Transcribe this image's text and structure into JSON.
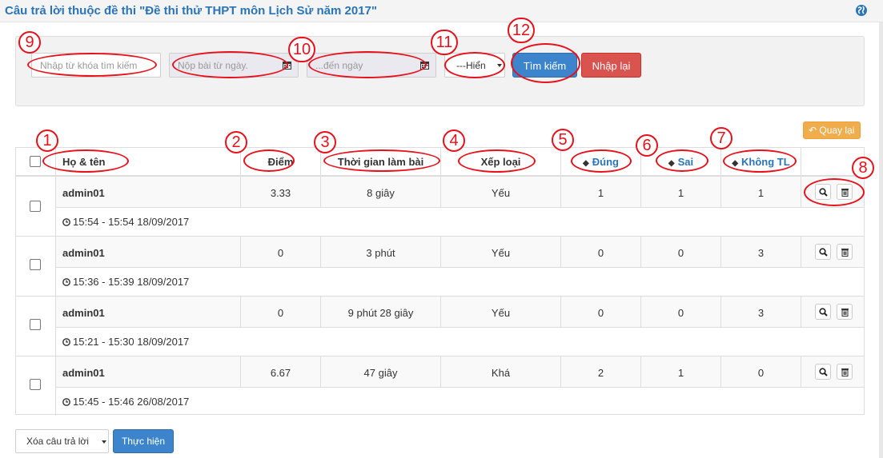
{
  "header": {
    "title": "Câu trả lời thuộc đề thi \"Đề thi thử THPT môn Lịch Sử năm 2017\""
  },
  "filters": {
    "keyword_placeholder": "Nhập từ khóa tìm kiếm",
    "from_date_placeholder": "Nộp bài từ ngày.",
    "to_date_placeholder": "...đến ngày",
    "rank_select": "---Hiển",
    "search_label": "Tìm kiếm",
    "reset_label": "Nhập lại"
  },
  "back_label": "Quay lại",
  "table": {
    "headers": [
      "Họ & tên",
      "Điểm",
      "Thời gian làm bài",
      "Xếp loại",
      "Đúng",
      "Sai",
      "Không TL"
    ],
    "rows": [
      {
        "name": "admin01",
        "score": "3.33",
        "duration": "8 giây",
        "rank": "Yếu",
        "correct": "1",
        "wrong": "1",
        "blank": "1",
        "time": "15:54 - 15:54 18/09/2017"
      },
      {
        "name": "admin01",
        "score": "0",
        "duration": "3 phút",
        "rank": "Yếu",
        "correct": "0",
        "wrong": "0",
        "blank": "3",
        "time": "15:36 - 15:39 18/09/2017"
      },
      {
        "name": "admin01",
        "score": "0",
        "duration": "9 phút 28 giây",
        "rank": "Yếu",
        "correct": "0",
        "wrong": "0",
        "blank": "3",
        "time": "15:21 - 15:30 18/09/2017"
      },
      {
        "name": "admin01",
        "score": "6.67",
        "duration": "47 giây",
        "rank": "Khá",
        "correct": "2",
        "wrong": "1",
        "blank": "0",
        "time": "15:45 - 15:46 26/08/2017"
      }
    ]
  },
  "bulk": {
    "select": "Xóa câu trả lời",
    "execute_label": "Thực hiện"
  },
  "annotations": [
    "1",
    "2",
    "3",
    "4",
    "5",
    "6",
    "7",
    "8",
    "9",
    "10",
    "11",
    "12"
  ],
  "colors": {
    "accent": "#2a74b8",
    "annotation": "#e8101a",
    "search_button": "#3c85cc",
    "reset_button": "#d9534f",
    "back_button": "#f0ad4e"
  }
}
